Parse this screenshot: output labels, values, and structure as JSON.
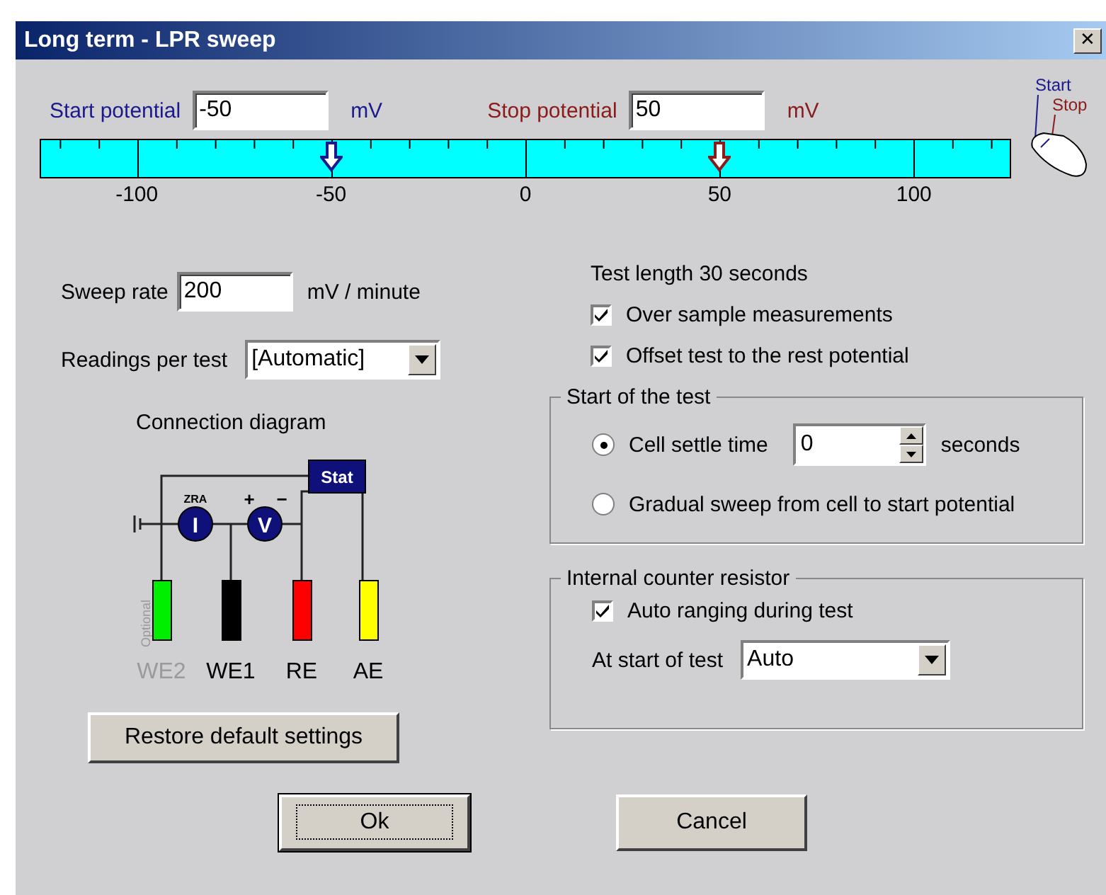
{
  "window": {
    "title": "Long term - LPR sweep",
    "close": "✕"
  },
  "start_potential": {
    "label": "Start potential",
    "value": "-50",
    "unit": "mV",
    "level": 0.3
  },
  "stop_potential": {
    "label": "Stop potential",
    "value": "50",
    "unit": "mV",
    "level": 0.7
  },
  "scale": {
    "labels": [
      "-100",
      "-50",
      "0",
      "50",
      "100"
    ]
  },
  "mouse_hint": {
    "start": "Start",
    "stop": "Stop"
  },
  "sweep_rate": {
    "label": "Sweep rate",
    "value": "200",
    "unit": "mV / minute"
  },
  "readings_per_test": {
    "label": "Readings per test",
    "value": "[Automatic]"
  },
  "connection_diagram": {
    "title": "Connection diagram",
    "stat": "Stat",
    "zra": "ZRA",
    "current": "I",
    "voltage": "V",
    "plus": "+",
    "minus": "−",
    "optional_label": "Optional",
    "electrodes": [
      {
        "label": "WE2",
        "color": "#00ee00",
        "optional": true
      },
      {
        "label": "WE1",
        "color": "#000000",
        "optional": false
      },
      {
        "label": "RE",
        "color": "#ff0000",
        "optional": false
      },
      {
        "label": "AE",
        "color": "#ffff00",
        "optional": false
      }
    ]
  },
  "restore_button": "Restore default settings",
  "test_length": "Test length 30 seconds",
  "options": [
    {
      "label": "Over sample measurements",
      "checked": true
    },
    {
      "label": "Offset test to the rest potential",
      "checked": true
    }
  ],
  "start_of_test": {
    "title": "Start of the test",
    "choices": [
      {
        "kind": "spin",
        "label": "Cell settle time",
        "selected": true,
        "value": "0",
        "unit": "seconds"
      },
      {
        "kind": "plain",
        "label": "Gradual sweep from cell to start potential",
        "selected": false
      }
    ]
  },
  "counter_resistor": {
    "title": "Internal counter resistor",
    "auto_ranging": {
      "label": "Auto ranging during test",
      "checked": true
    },
    "start_label": "At start of test",
    "start_value": "Auto"
  },
  "buttons": [
    {
      "label": "Ok",
      "focused": true
    },
    {
      "label": "Cancel",
      "focused": false
    }
  ]
}
